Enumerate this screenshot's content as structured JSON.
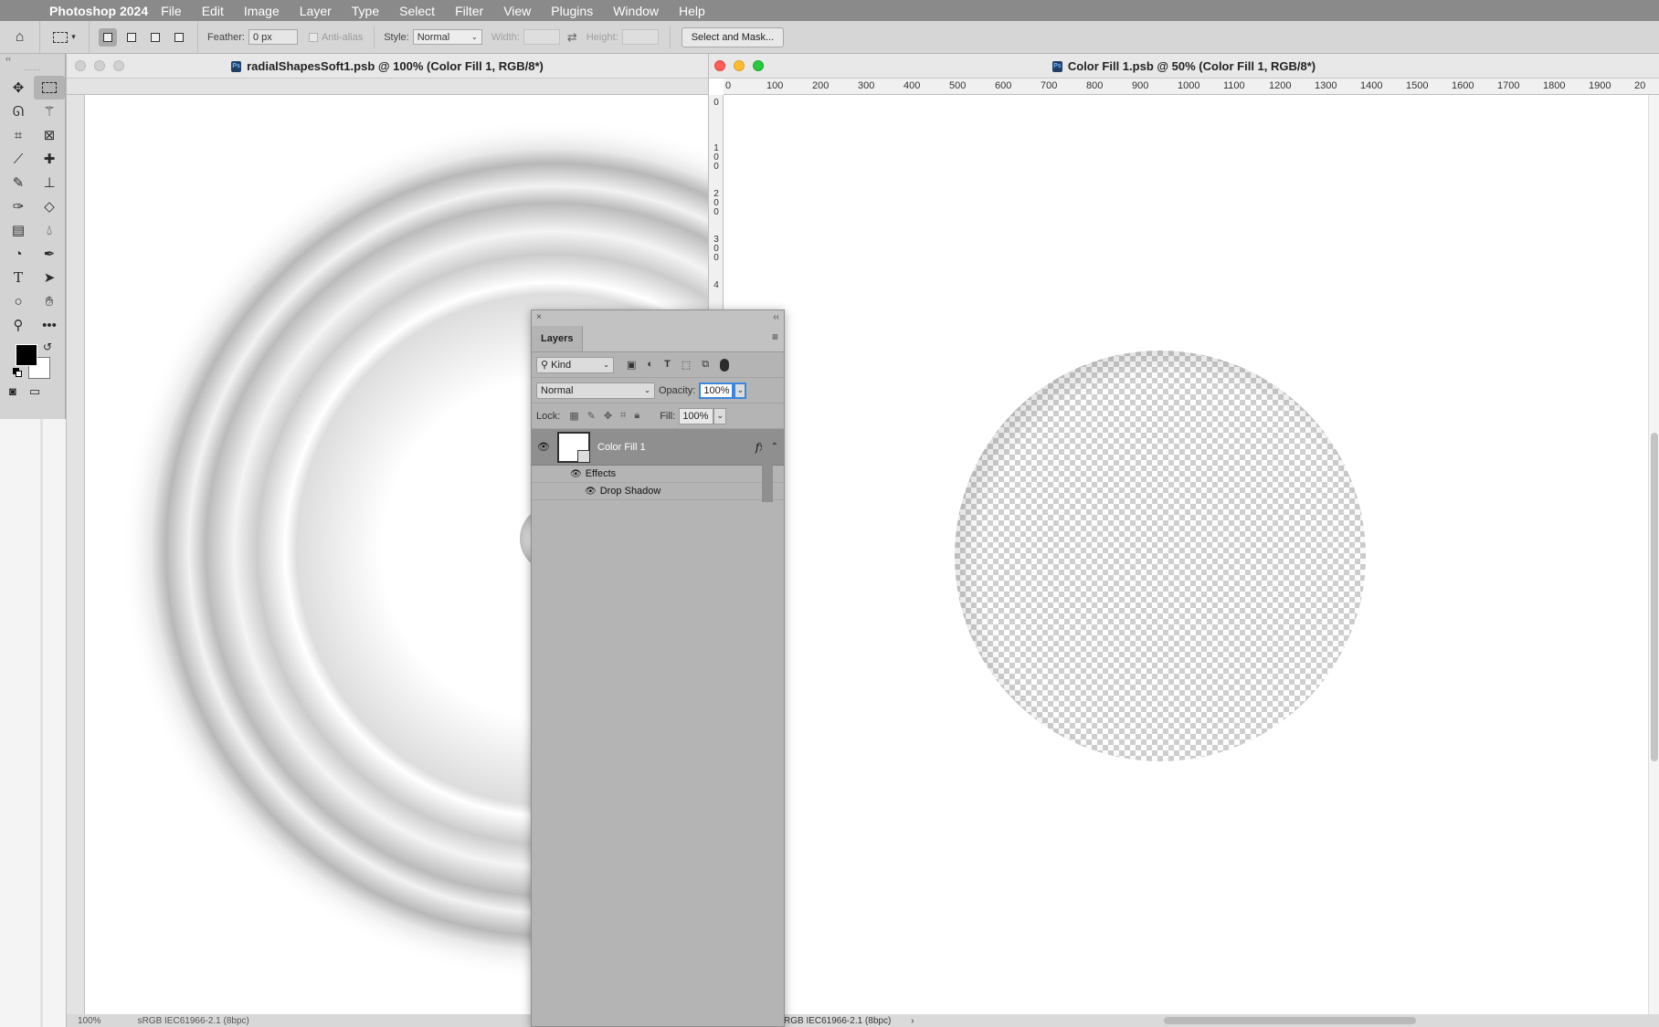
{
  "menubar": {
    "app_name": "Photoshop 2024",
    "items": [
      "File",
      "Edit",
      "Image",
      "Layer",
      "Type",
      "Select",
      "Filter",
      "View",
      "Plugins",
      "Window",
      "Help"
    ]
  },
  "options": {
    "feather_label": "Feather:",
    "feather_value": "0 px",
    "antialias_label": "Anti-alias",
    "style_label": "Style:",
    "style_value": "Normal",
    "width_label": "Width:",
    "height_label": "Height:",
    "select_mask_label": "Select and Mask..."
  },
  "doc1": {
    "title": "radialShapesSoft1.psb @ 100% (Color Fill 1, RGB/8*)",
    "zoom": "100%",
    "profile": "sRGB IEC61966-2.1 (8bpc)"
  },
  "doc2": {
    "title": "Color Fill 1.psb @ 50% (Color Fill 1, RGB/8*)",
    "ruler_ticks": [
      "0",
      "100",
      "200",
      "300",
      "400",
      "500",
      "600",
      "700",
      "800",
      "900",
      "1000",
      "1100",
      "1200",
      "1300",
      "1400",
      "1500",
      "1600",
      "1700",
      "1800",
      "1900",
      "20"
    ],
    "vruler_marks": [
      "0",
      "1 0 0",
      "2 0 0",
      "3 0 0",
      "4"
    ],
    "profile": "RGB IEC61966-2.1 (8bpc)"
  },
  "layers_panel": {
    "tab": "Layers",
    "kind_label": "Kind",
    "blend_mode": "Normal",
    "opacity_label": "Opacity:",
    "opacity_value": "100%",
    "lock_label": "Lock:",
    "fill_label": "Fill:",
    "fill_value": "100%",
    "layer_name": "Color Fill 1",
    "fx_label": "fx",
    "effects_label": "Effects",
    "effect_item": "Drop Shadow"
  },
  "icons": [
    "apple-icon",
    "home-icon",
    "move-icon",
    "marquee-icon",
    "lasso-icon",
    "magic-wand-icon",
    "crop-icon",
    "frame-icon",
    "eyedropper-icon",
    "healing-icon",
    "brush-icon",
    "stamp-icon",
    "history-brush-icon",
    "eraser-icon",
    "gradient-icon",
    "blur-icon",
    "dodge-icon",
    "pen-icon",
    "type-icon",
    "path-select-icon",
    "ellipse-icon",
    "hand-icon",
    "zoom-icon",
    "more-icon",
    "eye-icon",
    "lock-icon"
  ],
  "colors": {
    "foreground": "#000000",
    "background": "#ffffff",
    "close": "#ff5f57",
    "minimize": "#febc2e",
    "zoom": "#28c840"
  }
}
